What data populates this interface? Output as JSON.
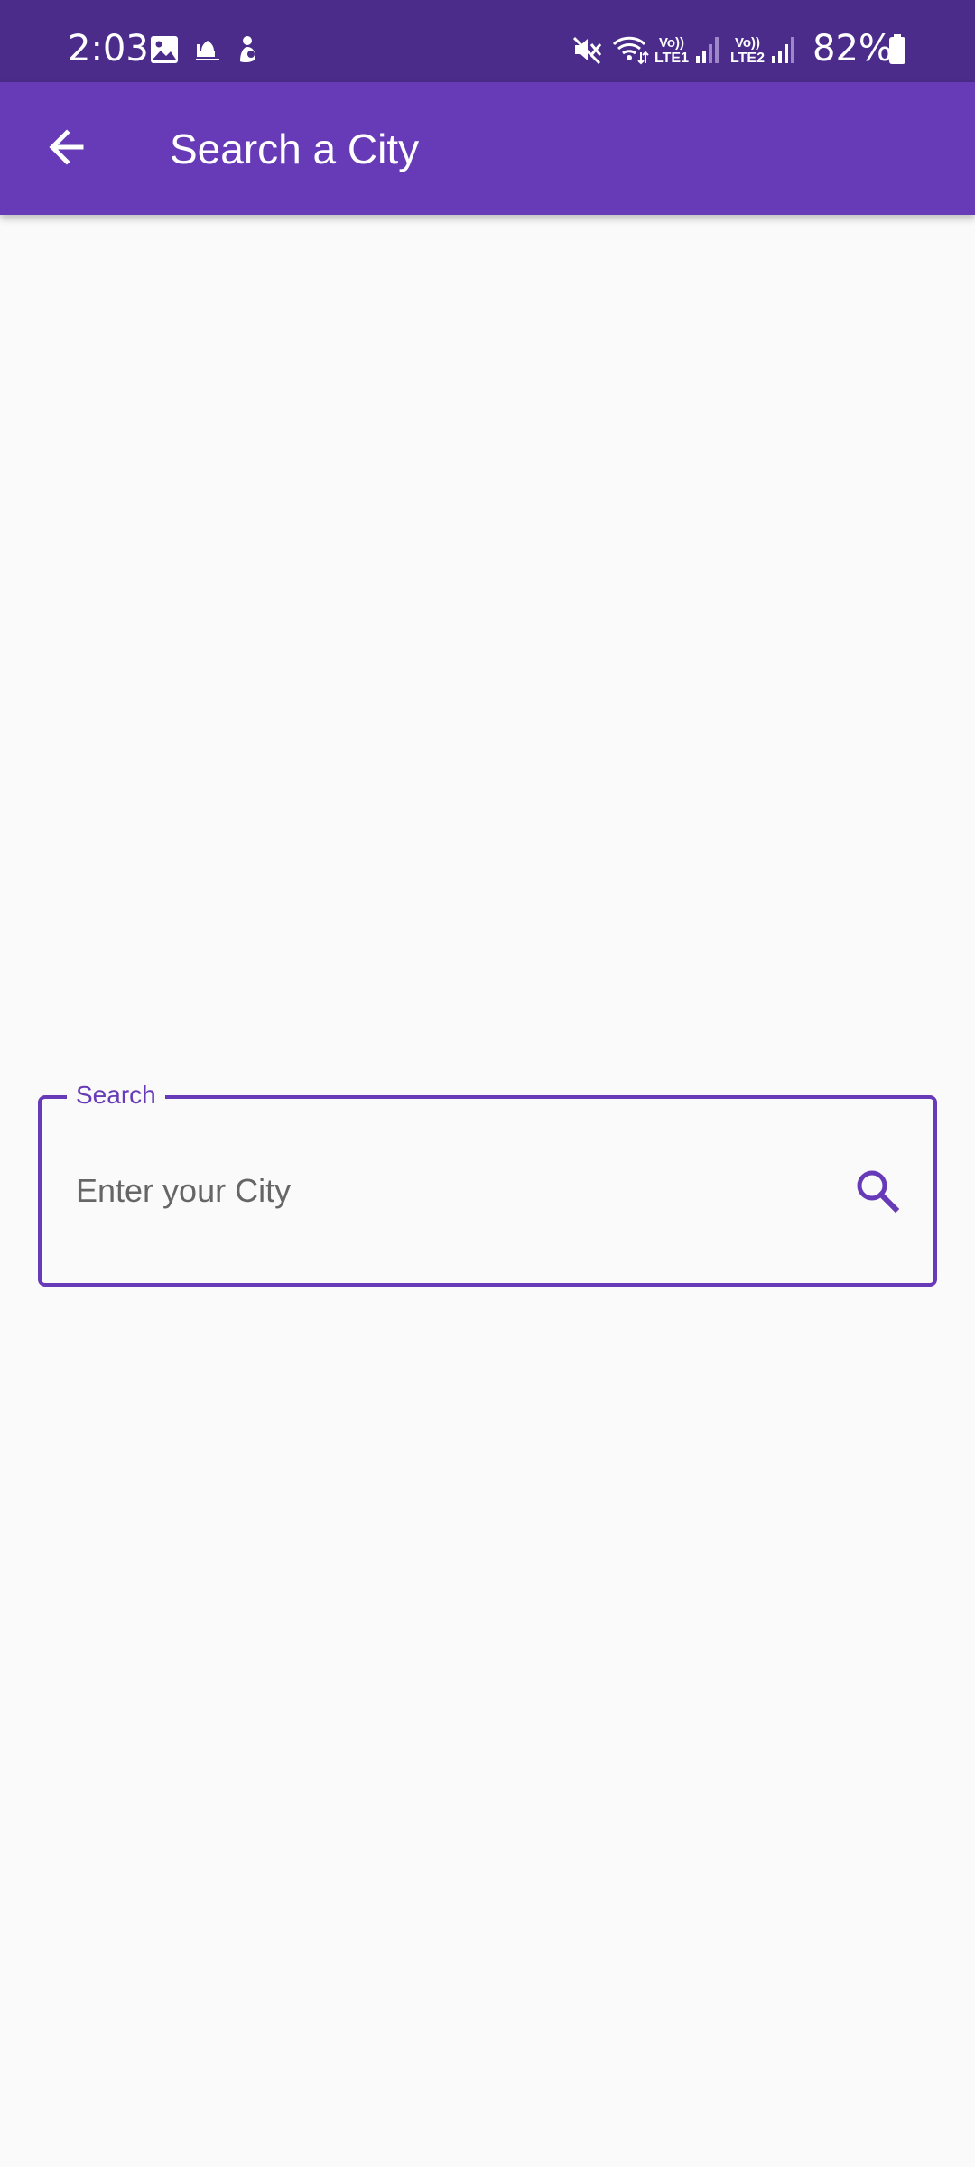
{
  "status_bar": {
    "time": "2:03",
    "battery_percent": "82%",
    "notification_icons": [
      "image-icon",
      "mosque-icon",
      "baby-icon"
    ],
    "system_icons": [
      "mute-icon",
      "wifi-icon",
      "volte1-signal-icon",
      "volte2-signal-icon",
      "battery-icon"
    ],
    "sim1_label_top": "Vo))",
    "sim1_label_bottom": "LTE1",
    "sim2_label_top": "Vo))",
    "sim2_label_bottom": "LTE2"
  },
  "app_bar": {
    "title": "Search a City",
    "back_icon": "arrow-back-icon"
  },
  "search": {
    "legend": "Search",
    "placeholder": "Enter your City",
    "value": "",
    "icon": "search-icon"
  },
  "colors": {
    "status_bar": "#4b2c8a",
    "app_bar": "#673ab7",
    "accent": "#673ab7",
    "background": "#fafafa"
  }
}
